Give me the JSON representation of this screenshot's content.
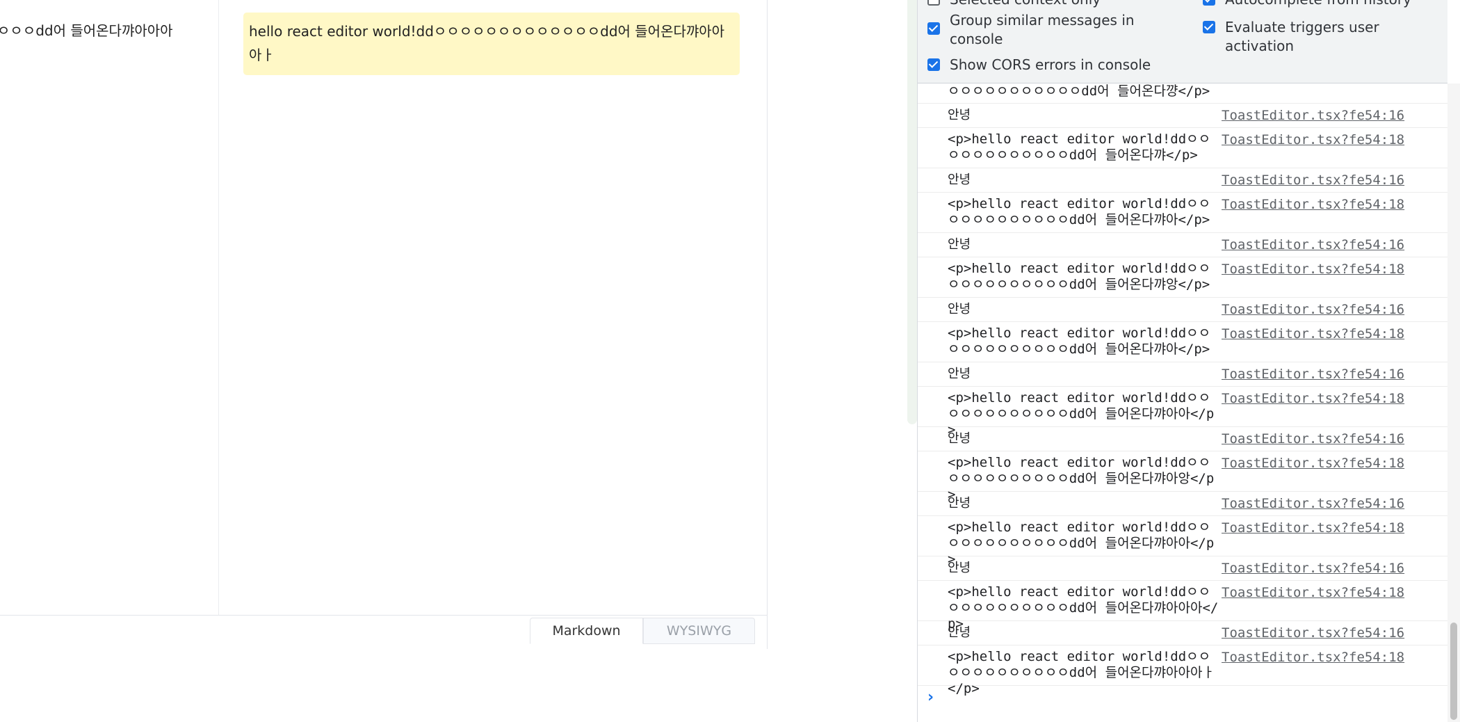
{
  "editor": {
    "markdown_line": "ㅇㅇㅇdd어 들어온다꺄아아아",
    "preview_text": "hello react editor world!ddㅇㅇㅇㅇㅇㅇㅇㅇㅇㅇㅇㅇㅇdd어 들어온다꺄아아아ㅏ",
    "tabs": {
      "markdown": "Markdown",
      "wysiwyg": "WYSIWYG"
    }
  },
  "devtools": {
    "settings": {
      "clipped_left": "Selected context only",
      "clipped_right": "Autocomplete from history",
      "group_similar": "Group similar messages in console",
      "evaluate_triggers": "Evaluate triggers user activation",
      "show_cors": "Show CORS errors in console"
    },
    "console": {
      "top_clipped": "ㅇㅇㅇㅇㅇㅇㅇㅇㅇㅇㅇdd어 들어온다꺙</p>",
      "rows": [
        {
          "msg": "안녕",
          "src": "ToastEditor.tsx?fe54:16"
        },
        {
          "msg": "<p>hello react editor world!ddㅇㅇㅇㅇㅇㅇㅇㅇㅇㅇㅇㅇdd어 들어온다꺄</p>",
          "src": "ToastEditor.tsx?fe54:18"
        },
        {
          "msg": "안녕",
          "src": "ToastEditor.tsx?fe54:16"
        },
        {
          "msg": "<p>hello react editor world!ddㅇㅇㅇㅇㅇㅇㅇㅇㅇㅇㅇㅇdd어 들어온다꺄아</p>",
          "src": "ToastEditor.tsx?fe54:18"
        },
        {
          "msg": "안녕",
          "src": "ToastEditor.tsx?fe54:16"
        },
        {
          "msg": "<p>hello react editor world!ddㅇㅇㅇㅇㅇㅇㅇㅇㅇㅇㅇㅇdd어 들어온다꺄앙</p>",
          "src": "ToastEditor.tsx?fe54:18"
        },
        {
          "msg": "안녕",
          "src": "ToastEditor.tsx?fe54:16"
        },
        {
          "msg": "<p>hello react editor world!ddㅇㅇㅇㅇㅇㅇㅇㅇㅇㅇㅇㅇdd어 들어온다꺄아</p>",
          "src": "ToastEditor.tsx?fe54:18"
        },
        {
          "msg": "안녕",
          "src": "ToastEditor.tsx?fe54:16"
        },
        {
          "msg": "<p>hello react editor world!ddㅇㅇㅇㅇㅇㅇㅇㅇㅇㅇㅇㅇdd어 들어온다꺄아아</p>",
          "src": "ToastEditor.tsx?fe54:18"
        },
        {
          "msg": "안녕",
          "src": "ToastEditor.tsx?fe54:16"
        },
        {
          "msg": "<p>hello react editor world!ddㅇㅇㅇㅇㅇㅇㅇㅇㅇㅇㅇㅇdd어 들어온다꺄아앙</p>",
          "src": "ToastEditor.tsx?fe54:18"
        },
        {
          "msg": "안녕",
          "src": "ToastEditor.tsx?fe54:16"
        },
        {
          "msg": "<p>hello react editor world!ddㅇㅇㅇㅇㅇㅇㅇㅇㅇㅇㅇㅇdd어 들어온다꺄아아</p>",
          "src": "ToastEditor.tsx?fe54:18"
        },
        {
          "msg": "안녕",
          "src": "ToastEditor.tsx?fe54:16"
        },
        {
          "msg": "<p>hello react editor world!ddㅇㅇㅇㅇㅇㅇㅇㅇㅇㅇㅇㅇdd어 들어온다꺄아아아</p>",
          "src": "ToastEditor.tsx?fe54:18"
        },
        {
          "msg": "안녕",
          "src": "ToastEditor.tsx?fe54:16"
        },
        {
          "msg": "<p>hello react editor world!ddㅇㅇㅇㅇㅇㅇㅇㅇㅇㅇㅇㅇdd어 들어온다꺄아아아ㅏ</p>",
          "src": "ToastEditor.tsx?fe54:18"
        }
      ],
      "prompt_icon": "chevron-right-icon"
    }
  },
  "colors": {
    "accent": "#1a73e8",
    "highlight": "#fff8c6"
  }
}
